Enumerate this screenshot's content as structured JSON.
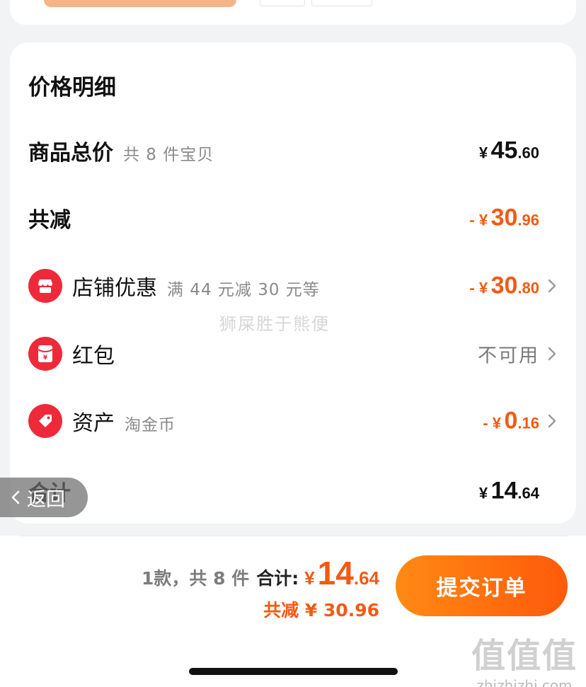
{
  "page": {
    "title": "价格明细",
    "watermark_text": "狮屎胜于熊便"
  },
  "rows": {
    "goods_total": {
      "label": "商品总价",
      "sub": "共 8 件宝贝",
      "currency": "¥",
      "int": "45",
      "dec": ".60"
    },
    "total_discount": {
      "label": "共减",
      "prefix": "- ",
      "currency": "¥",
      "int": "30",
      "dec": ".96"
    },
    "store_discount": {
      "label": "店铺优惠",
      "sub": "满 44 元减 30 元等",
      "prefix": "- ",
      "currency": "¥",
      "int": "30",
      "dec": ".80",
      "icon": "store-icon"
    },
    "red_packet": {
      "label": "红包",
      "value": "不可用",
      "icon": "red-packet-icon"
    },
    "assets": {
      "label": "资产",
      "sub": "淘金币",
      "prefix": "- ",
      "currency": "¥",
      "int": "0",
      "dec": ".16",
      "icon": "tag-icon"
    },
    "grand_total": {
      "label": "合计",
      "currency": "¥",
      "int": "14",
      "dec": ".64"
    }
  },
  "back_pill": {
    "label": "返回"
  },
  "bottom_bar": {
    "count_text": "1款，共 8 件",
    "total_label": "合计:",
    "currency": "¥",
    "total_int": "14",
    "total_dec": ".64",
    "saving_text": "共减 ¥ 30.96",
    "submit_label": "提交订单"
  },
  "brand_watermark": {
    "big": "值值值",
    "small": "zhizhizhi.com"
  },
  "colors": {
    "accent": "#f25a14",
    "icon_red": "#ee2a3a",
    "button_start": "#ff8a14",
    "button_end": "#ff5a0a"
  }
}
